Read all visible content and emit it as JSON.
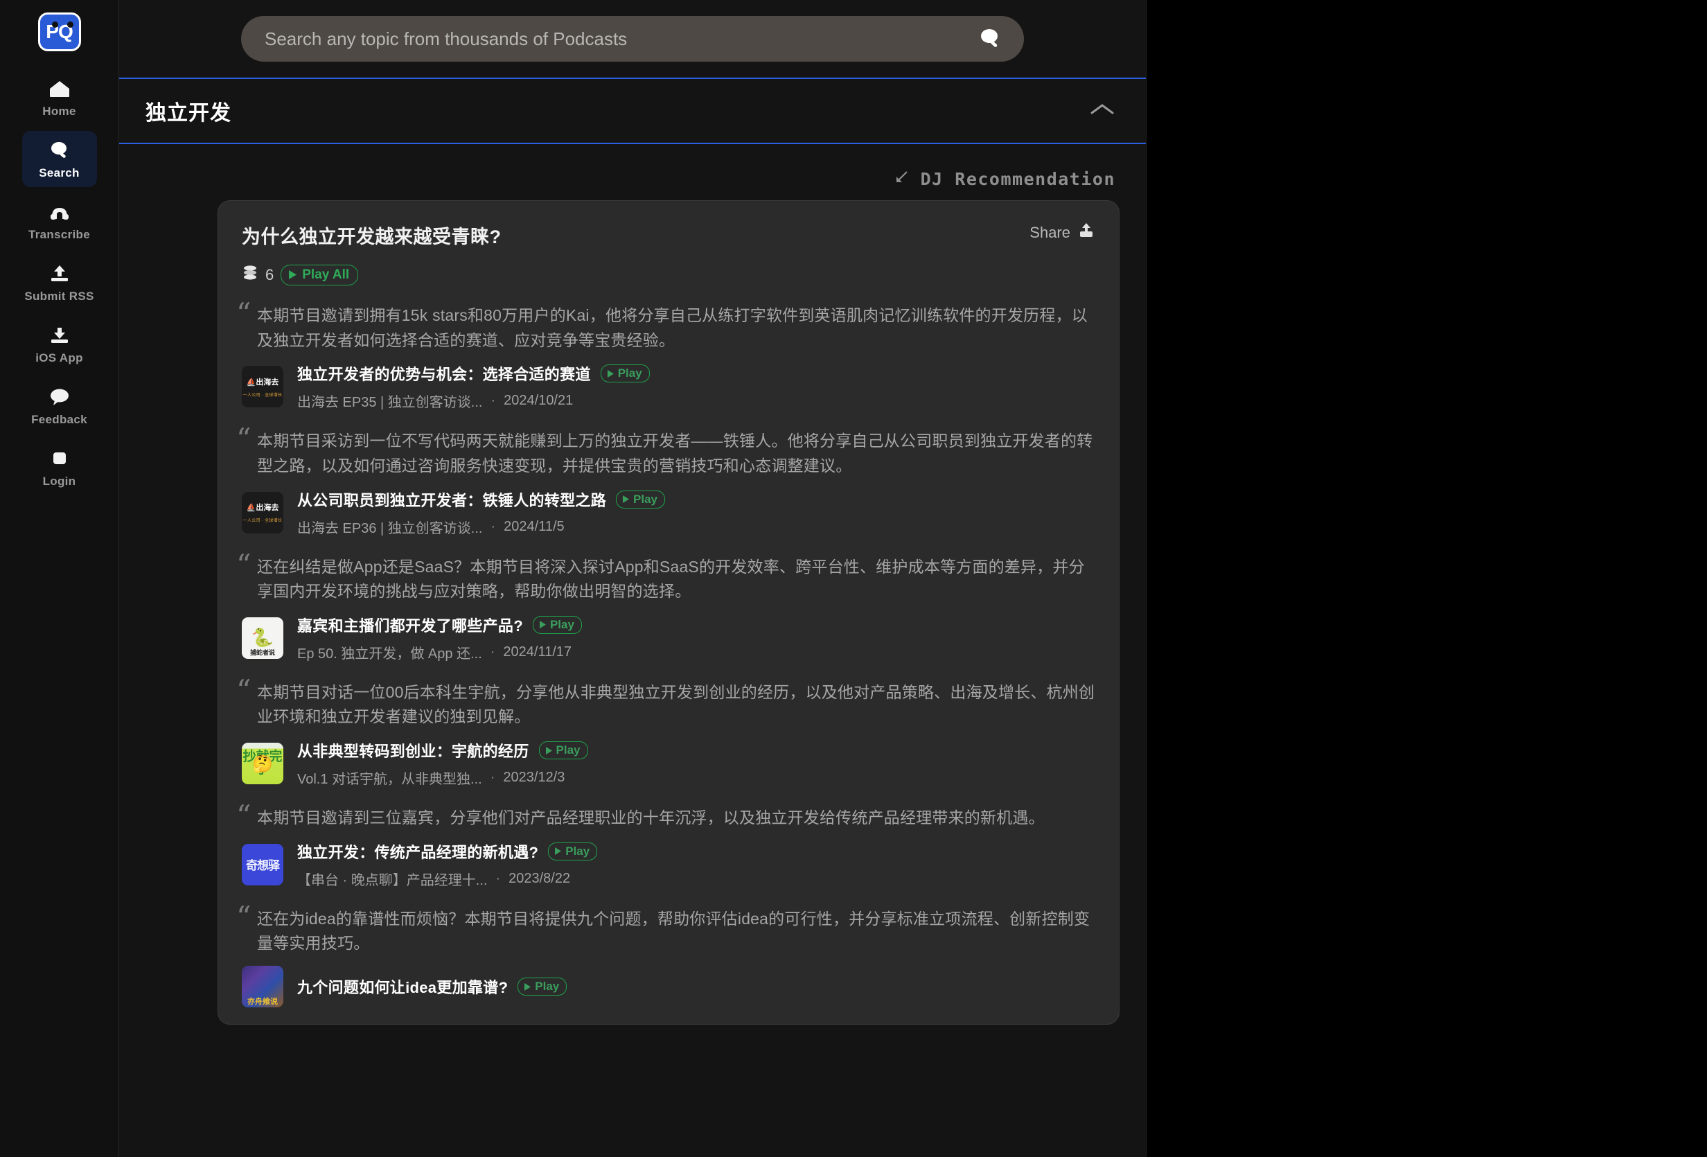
{
  "sidebar": {
    "logo_text": "PQ",
    "items": [
      {
        "label": "Home",
        "icon": "home-icon",
        "active": false
      },
      {
        "label": "Search",
        "icon": "search-icon",
        "active": true
      },
      {
        "label": "Transcribe",
        "icon": "transcribe-icon",
        "active": false
      },
      {
        "label": "Submit RSS",
        "icon": "upload-icon",
        "active": false
      },
      {
        "label": "iOS App",
        "icon": "download-icon",
        "active": false
      },
      {
        "label": "Feedback",
        "icon": "chat-bubble-icon",
        "active": false
      },
      {
        "label": "Login",
        "icon": "login-icon",
        "active": false
      }
    ]
  },
  "search": {
    "placeholder": "Search any topic from thousands of Podcasts",
    "value": ""
  },
  "section": {
    "title": "独立开发",
    "collapse_icon": "chevron-up-icon"
  },
  "dj": {
    "label": "DJ Recommendation",
    "icon": "arrow-down-left-icon"
  },
  "card": {
    "title": "为什么独立开发越来越受青睐?",
    "share_label": "Share",
    "share_icon": "share-upload-icon",
    "stack_icon": "stack-icon",
    "count": "6",
    "play_all_label": "Play All",
    "accent_green": "#2faa58",
    "accent_blue": "#2b5fdf",
    "card_bg": "#2b2b2b",
    "page_bg": "#141414"
  },
  "episodes": [
    {
      "description": "本期节目邀请到拥有15k stars和80万用户的Kai，他将分享自己从练打字软件到英语肌肉记忆训练软件的开发历程，以及独立开发者如何选择合适的赛道、应对竞争等宝贵经验。",
      "title": "独立开发者的优势与机会：选择合适的赛道",
      "play_label": "Play",
      "podcast": "出海去 EP35 | 独立创客访谈...",
      "date": "2024/10/21",
      "thumb": {
        "style": "dark-sail",
        "main": "⛵出海去",
        "sub": "一人公司 · 全球增长"
      }
    },
    {
      "description": "本期节目采访到一位不写代码两天就能赚到上万的独立开发者——铁锤人。他将分享自己从公司职员到独立开发者的转型之路，以及如何通过咨询服务快速变现，并提供宝贵的营销技巧和心态调整建议。",
      "title": "从公司职员到独立开发者：铁锤人的转型之路",
      "play_label": "Play",
      "podcast": "出海去 EP36 | 独立创客访谈...",
      "date": "2024/11/5",
      "thumb": {
        "style": "dark-sail",
        "main": "⛵出海去",
        "sub": "一人公司 · 全球增长"
      }
    },
    {
      "description": "还在纠结是做App还是SaaS？本期节目将深入探讨App和SaaS的开发效率、跨平台性、维护成本等方面的差异，并分享国内开发环境的挑战与应对策略，帮助你做出明智的选择。",
      "title": "嘉宾和主播们都开发了哪些产品?",
      "play_label": "Play",
      "podcast": "Ep 50. 独立开发，做 App 还...",
      "date": "2024/11/17",
      "thumb": {
        "style": "white-snake",
        "main": "🐍",
        "sub": "捕蛇者说"
      }
    },
    {
      "description": "本期节目对话一位00后本科生宇航，分享他从非典型独立开发到创业的经历，以及他对产品策略、出海及增长、杭州创业环境和独立开发者建议的独到见解。",
      "title": "从非典型转码到创业：宇航的经历",
      "play_label": "Play",
      "podcast": "Vol.1 对话宇航，从非典型独...",
      "date": "2023/12/3",
      "thumb": {
        "style": "green-copy",
        "main": "抄就完了",
        "sub": ""
      }
    },
    {
      "description": "本期节目邀请到三位嘉宾，分享他们对产品经理职业的十年沉浮，以及独立开发给传统产品经理带来的新机遇。",
      "title": "独立开发：传统产品经理的新机遇?",
      "play_label": "Play",
      "podcast": "【串台 · 晚点聊】产品经理十...",
      "date": "2023/8/22",
      "thumb": {
        "style": "blue-qixiang",
        "main": "奇想驿",
        "sub": ""
      }
    },
    {
      "description": "还在为idea的靠谱性而烦恼？本期节目将提供九个问题，帮助你评估idea的可行性，并分享标准立项流程、创新控制变量等实用技巧。",
      "title": "九个问题如何让idea更加靠谱?",
      "play_label": "Play",
      "podcast": "",
      "date": "",
      "thumb": {
        "style": "art-poster",
        "main": "",
        "sub": "亦舟飨说"
      }
    }
  ]
}
